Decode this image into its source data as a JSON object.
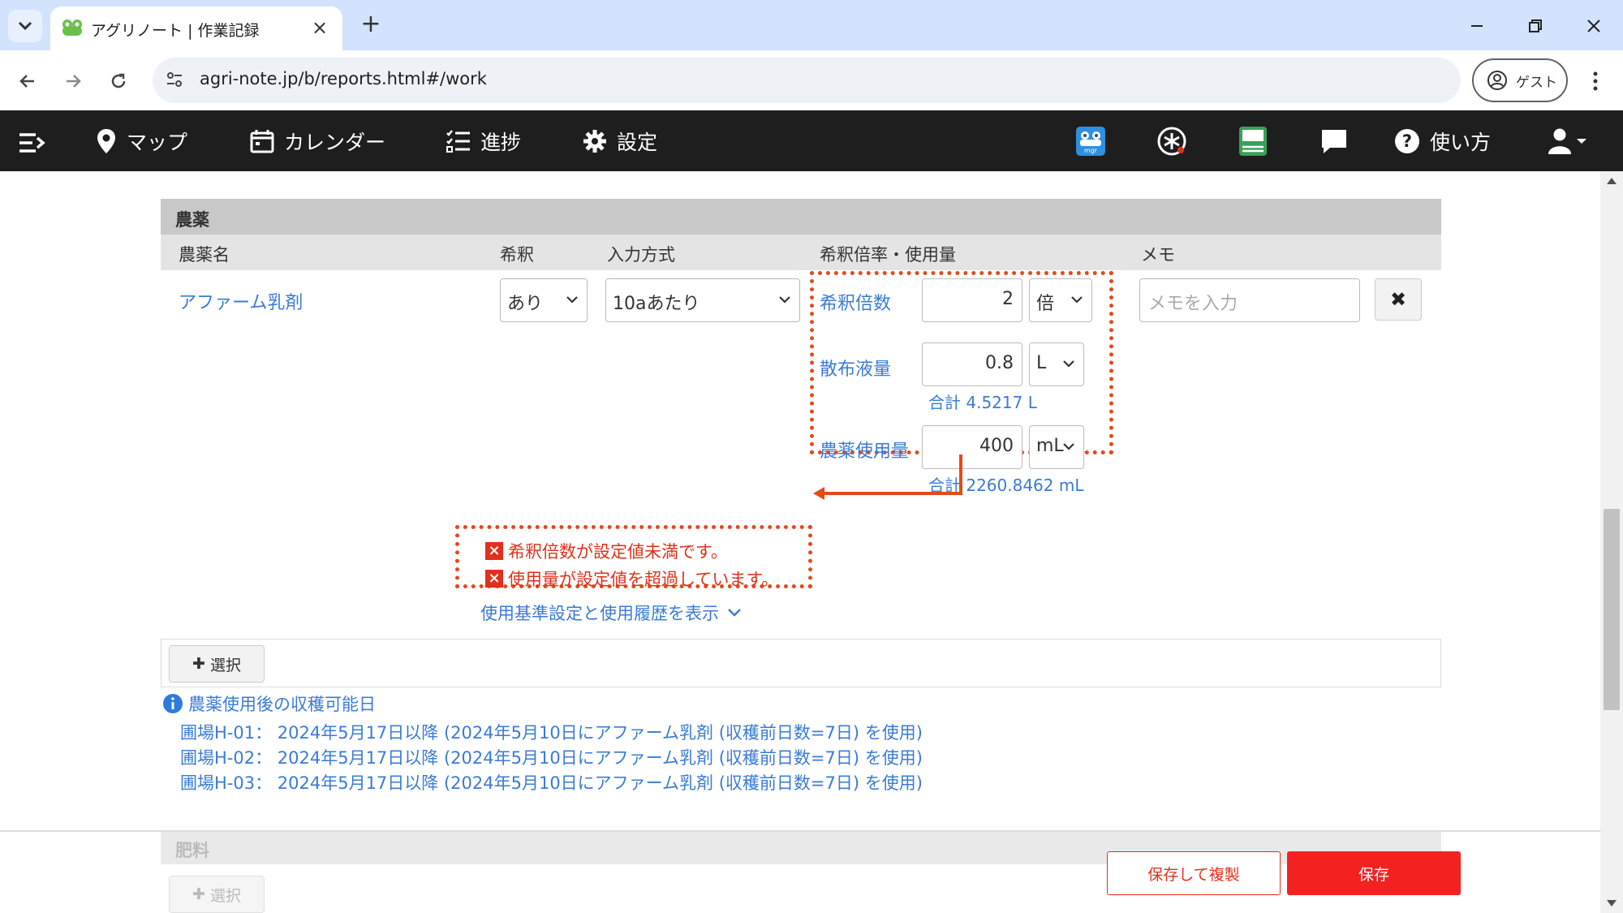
{
  "browser": {
    "tab_title": "アグリノート | 作業記録",
    "url": "agri-note.jp/b/reports.html#/work",
    "profile_label": "ゲスト"
  },
  "appnav": {
    "items": [
      {
        "label": "マップ",
        "icon": "map-pin-icon"
      },
      {
        "label": "カレンダー",
        "icon": "calendar-icon"
      },
      {
        "label": "進捗",
        "icon": "checklist-icon"
      },
      {
        "label": "設定",
        "icon": "gear-icon"
      }
    ],
    "help_label": "使い方",
    "right_icons": [
      "mgr-icon",
      "asterisk-icon",
      "pesticide-search-icon",
      "chat-icon",
      "help-icon",
      "user-icon"
    ]
  },
  "pesticide": {
    "section_title": "農薬",
    "columns": [
      "農薬名",
      "希釈",
      "入力方式",
      "希釈倍率・使用量",
      "メモ"
    ],
    "name": "アファーム乳剤",
    "dilution": "あり",
    "input_method": "10aあたり",
    "dilution_ratio": {
      "label": "希釈倍数",
      "value": "2",
      "unit": "倍"
    },
    "spray_volume": {
      "label": "散布液量",
      "value": "0.8",
      "unit": "L",
      "total": "合計 4.5217 L"
    },
    "usage_amount": {
      "label": "農薬使用量",
      "value": "400",
      "unit": "mL",
      "total": "合計 2260.8462 mL"
    },
    "memo_placeholder": "メモを入力",
    "errors": [
      "希釈倍数が設定値未満です。",
      "使用量が設定値を超過しています。"
    ],
    "show_history_link": "使用基準設定と使用履歴を表示",
    "select_button": "選択"
  },
  "harvest": {
    "title": "農薬使用後の収穫可能日",
    "lines": [
      "圃場H-01： 2024年5月17日以降 (2024年5月10日にアファーム乳剤 (収穫前日数=7日) を使用)",
      "圃場H-02： 2024年5月17日以降 (2024年5月10日にアファーム乳剤 (収穫前日数=7日) を使用)",
      "圃場H-03： 2024年5月17日以降 (2024年5月10日にアファーム乳剤 (収穫前日数=7日) を使用)"
    ]
  },
  "fertilizer": {
    "section_title": "肥料",
    "select_button": "選択"
  },
  "actions": {
    "save_copy": "保存して複製",
    "save": "保存"
  },
  "colors": {
    "accent_blue": "#3a7bd5",
    "error_red": "#e0301e",
    "save_red": "#f42121",
    "nav_bg": "#1e1e1e"
  }
}
